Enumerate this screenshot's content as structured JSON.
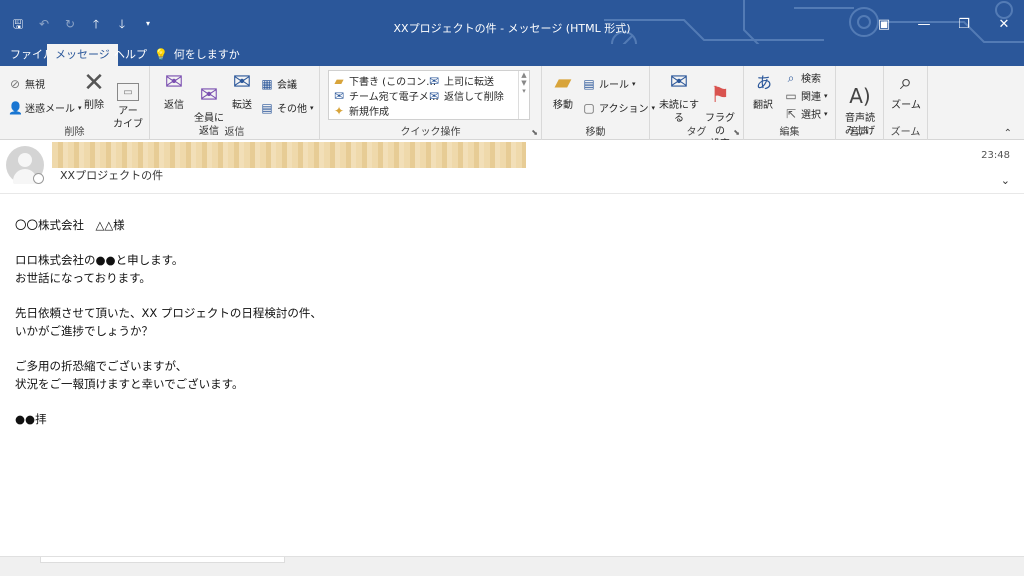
{
  "window": {
    "title": "XXプロジェクトの件 - メッセージ (HTML 形式)",
    "colors": {
      "titlebar": "#2b579a",
      "ribbon": "#f3f3f3"
    }
  },
  "tabs": [
    {
      "label": "ファイル"
    },
    {
      "label": "メッセージ"
    },
    {
      "label": "ヘルプ"
    },
    {
      "label": "何をしますか"
    }
  ],
  "ribbon": {
    "delete_group": {
      "ignore": "無視",
      "junk": "迷惑メール",
      "delete": "削除",
      "archive": "アー\nカイブ",
      "label": "削除"
    },
    "respond_group": {
      "reply": "返信",
      "reply_all": "全員に\n返信",
      "forward": "転送",
      "meeting": "会議",
      "more": "その他",
      "label": "返信"
    },
    "quick_steps": {
      "items": [
        "下書き (このコン…",
        "上司に転送",
        "チーム宛て電子メ…",
        "返信して削除",
        "新規作成"
      ],
      "label": "クイック操作"
    },
    "move_group": {
      "move": "移動",
      "rules": "ルール",
      "actions": "アクション",
      "label": "移動"
    },
    "tags_group": {
      "unread": "未読にする",
      "flag": "フラグの\n設定",
      "label": "タグ"
    },
    "editing_group": {
      "translate": "翻訳",
      "find": "検索",
      "related": "関連",
      "select": "選択",
      "label": "編集"
    },
    "speech_group": {
      "read_aloud": "音声読\nみ上げ",
      "label": "音声"
    },
    "zoom_group": {
      "zoom": "ズーム",
      "label": "ズーム"
    }
  },
  "message": {
    "subject": "XXプロジェクトの件",
    "time": "23:48",
    "body": [
      "〇〇株式会社　△△様",
      "",
      "ロロ株式会社の●●と申します。",
      "お世話になっております。",
      "",
      "先日依頼させて頂いた、XX プロジェクトの日程検討の件、",
      "いかがご進捗でしょうか？",
      "",
      "ご多用の折恐縮でございますが、",
      "状況をご一報頂けますと幸いでございます。",
      "",
      "●●拝"
    ]
  },
  "icons": [
    "save-icon",
    "undo-icon",
    "redo-icon",
    "up-arrow-icon",
    "down-arrow-icon",
    "customize-icon",
    "lightbulb-icon",
    "ribbon-display-icon",
    "minimize-icon",
    "restore-icon",
    "close-icon"
  ]
}
